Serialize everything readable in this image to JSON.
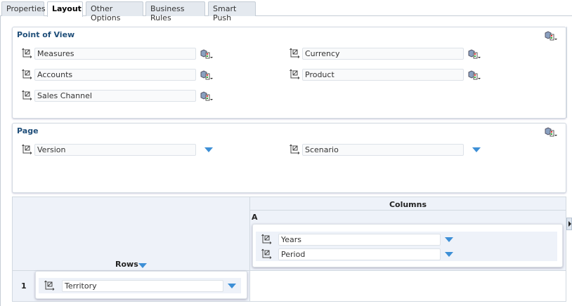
{
  "tabs": [
    {
      "label": "Properties"
    },
    {
      "label": "Layout"
    },
    {
      "label": "Other Options"
    },
    {
      "label": "Business Rules"
    },
    {
      "label": "Smart Push"
    }
  ],
  "pov": {
    "title": "Point of View",
    "dims": [
      {
        "label": "Measures"
      },
      {
        "label": "Currency"
      },
      {
        "label": "Accounts"
      },
      {
        "label": "Product"
      },
      {
        "label": "Sales Channel"
      }
    ]
  },
  "page": {
    "title": "Page",
    "dims": [
      {
        "label": "Version"
      },
      {
        "label": "Scenario"
      }
    ]
  },
  "grid": {
    "columns_label": "Columns",
    "column_id": "A",
    "rows_label": "Rows",
    "row_id": "1",
    "column_dims": [
      {
        "label": "Years"
      },
      {
        "label": "Period"
      }
    ],
    "row_dims": [
      {
        "label": "Territory"
      }
    ]
  },
  "icons": {
    "dimension": "pivot-dimension-icon",
    "member_selector": "member-selector-icon",
    "dropdown": "triangle-down-icon"
  },
  "colors": {
    "accent": "#3d8fd6",
    "title": "#1f4e79",
    "grid_bg": "#eef2f9"
  }
}
